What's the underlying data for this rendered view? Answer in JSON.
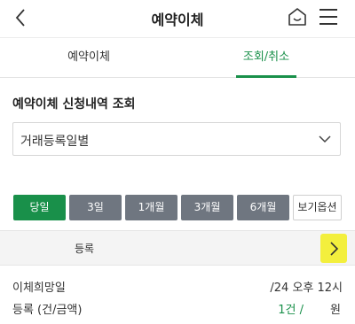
{
  "header": {
    "title": "예약이체",
    "back_icon": "chevron-left-icon",
    "home_icon": "home-icon",
    "menu_icon": "hamburger-menu-icon"
  },
  "tabs": [
    {
      "label": "예약이체",
      "active": false
    },
    {
      "label": "조회/취소",
      "active": true
    }
  ],
  "accent_color": "#19904a",
  "section": {
    "title": "예약이체 신청내역 조회",
    "select_value": "거래등록일별"
  },
  "periods": [
    {
      "label": "당일",
      "active": true
    },
    {
      "label": "3일",
      "active": false
    },
    {
      "label": "1개월",
      "active": false
    },
    {
      "label": "3개월",
      "active": false
    },
    {
      "label": "6개월",
      "active": false
    }
  ],
  "options_label": "보기옵션",
  "summary": {
    "label": "등록",
    "arrow_color": "#f3ef3d"
  },
  "details": {
    "desired_date_label": "이체희망일",
    "desired_date_value": "/24 오후 12시",
    "registered_label": "등록 (건/금액)",
    "registered_count": "1건 /",
    "registered_unit": "원"
  }
}
